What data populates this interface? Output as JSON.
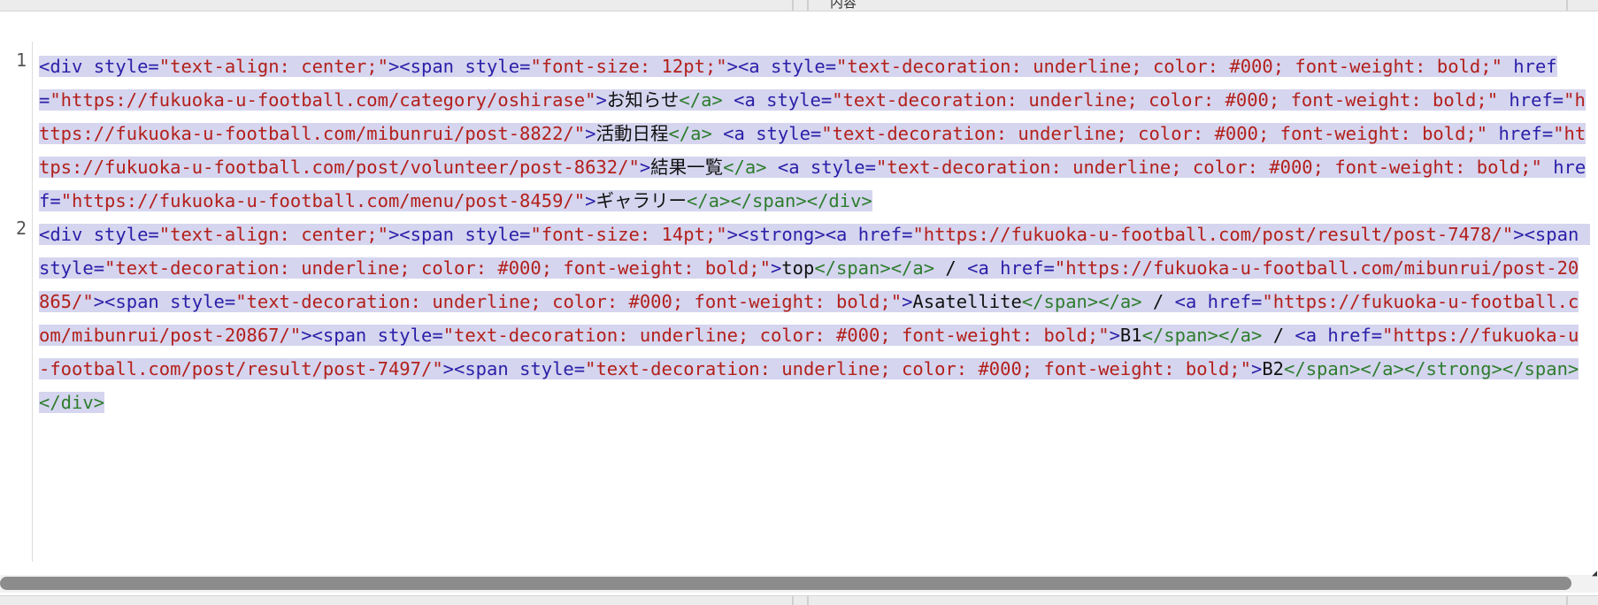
{
  "top_bar": {
    "partial_label": "内容"
  },
  "editor": {
    "lines": [
      {
        "number": "1",
        "segments": [
          {
            "c": "t",
            "v": "<div "
          },
          {
            "c": "t",
            "v": "style="
          },
          {
            "c": "s",
            "v": "\"text-align: center;\""
          },
          {
            "c": "t",
            "v": "><span "
          },
          {
            "c": "t",
            "v": "style="
          },
          {
            "c": "s",
            "v": "\"font-size: 12pt;\""
          },
          {
            "c": "t",
            "v": "><a "
          },
          {
            "c": "t",
            "v": "style="
          },
          {
            "c": "s",
            "v": "\"text-decoration: underline; color: #000; font-weight: bold;\" "
          },
          {
            "c": "t",
            "v": "href="
          },
          {
            "c": "s",
            "v": "\"https://fukuoka-u-football.com/category/oshirase\""
          },
          {
            "c": "t",
            "v": ">"
          },
          {
            "c": "x",
            "v": "お知らせ"
          },
          {
            "c": "g",
            "v": "</a> "
          },
          {
            "c": "t",
            "v": "<a "
          },
          {
            "c": "t",
            "v": "style="
          },
          {
            "c": "s",
            "v": "\"text-decoration: underline; color: #000; font-weight: bold;\" "
          },
          {
            "c": "t",
            "v": "href="
          },
          {
            "c": "s",
            "v": "\"https://fukuoka-u-football.com/mibunrui/post-8822/\""
          },
          {
            "c": "t",
            "v": ">"
          },
          {
            "c": "x",
            "v": "活動日程"
          },
          {
            "c": "g",
            "v": "</a> "
          },
          {
            "c": "t",
            "v": "<a "
          },
          {
            "c": "t",
            "v": "style="
          },
          {
            "c": "s",
            "v": "\"text-decoration: underline; color: #000; font-weight: bold;\" "
          },
          {
            "c": "t",
            "v": "href="
          },
          {
            "c": "s",
            "v": "\"https://fukuoka-u-football.com/post/volunteer/post-8632/\""
          },
          {
            "c": "t",
            "v": ">"
          },
          {
            "c": "x",
            "v": "結果一覧"
          },
          {
            "c": "g",
            "v": "</a> "
          },
          {
            "c": "t",
            "v": "<a "
          },
          {
            "c": "t",
            "v": "style="
          },
          {
            "c": "s",
            "v": "\"text-decoration: underline; color: #000; font-weight: bold;\" "
          },
          {
            "c": "t",
            "v": "href="
          },
          {
            "c": "s",
            "v": "\"https://fukuoka-u-football.com/menu/post-8459/\""
          },
          {
            "c": "t",
            "v": ">"
          },
          {
            "c": "x",
            "v": "ギャラリー"
          },
          {
            "c": "g",
            "v": "</a></span></div>"
          }
        ]
      },
      {
        "number": "2",
        "segments": [
          {
            "c": "t",
            "v": "<div "
          },
          {
            "c": "t",
            "v": "style="
          },
          {
            "c": "s",
            "v": "\"text-align: center;\""
          },
          {
            "c": "t",
            "v": "><span "
          },
          {
            "c": "t",
            "v": "style="
          },
          {
            "c": "s",
            "v": "\"font-size: 14pt;\""
          },
          {
            "c": "t",
            "v": "><strong><a "
          },
          {
            "c": "t",
            "v": "href="
          },
          {
            "c": "s",
            "v": "\"https://fukuoka-u-football.com/post/result/post-7478/\""
          },
          {
            "c": "t",
            "v": "><span "
          },
          {
            "c": "t",
            "v": "style="
          },
          {
            "c": "s",
            "v": "\"text-decoration: underline; color: #000; font-weight: bold;\""
          },
          {
            "c": "t",
            "v": ">"
          },
          {
            "c": "x",
            "v": "top"
          },
          {
            "c": "g",
            "v": "</span></a>"
          },
          {
            "c": "x",
            "v": " / "
          },
          {
            "c": "t",
            "v": "<a "
          },
          {
            "c": "t",
            "v": "href="
          },
          {
            "c": "s",
            "v": "\"https://fukuoka-u-football.com/mibunrui/post-20865/\""
          },
          {
            "c": "t",
            "v": "><span "
          },
          {
            "c": "t",
            "v": "style="
          },
          {
            "c": "s",
            "v": "\"text-decoration: underline; color: #000; font-weight: bold;\""
          },
          {
            "c": "t",
            "v": ">"
          },
          {
            "c": "x",
            "v": "Asatellite"
          },
          {
            "c": "g",
            "v": "</span></a>"
          },
          {
            "c": "x",
            "v": " / "
          },
          {
            "c": "t",
            "v": "<a "
          },
          {
            "c": "t",
            "v": "href="
          },
          {
            "c": "s",
            "v": "\"https://fukuoka-u-football.com/mibunrui/post-20867/\""
          },
          {
            "c": "t",
            "v": "><span "
          },
          {
            "c": "t",
            "v": "style="
          },
          {
            "c": "s",
            "v": "\"text-decoration: underline; color: #000; font-weight: bold;\""
          },
          {
            "c": "t",
            "v": ">"
          },
          {
            "c": "x",
            "v": "B1"
          },
          {
            "c": "g",
            "v": "</span></a>"
          },
          {
            "c": "x",
            "v": " / "
          },
          {
            "c": "t",
            "v": "<a "
          },
          {
            "c": "t",
            "v": "href="
          },
          {
            "c": "s",
            "v": "\"https://fukuoka-u-football.com/post/result/post-7497/\""
          },
          {
            "c": "t",
            "v": "><span "
          },
          {
            "c": "t",
            "v": "style="
          },
          {
            "c": "s",
            "v": "\"text-decoration: underline; color: #000; font-weight: bold;\""
          },
          {
            "c": "t",
            "v": ">"
          },
          {
            "c": "x",
            "v": "B2"
          },
          {
            "c": "g",
            "v": "</span></a></strong></span></div>"
          }
        ]
      }
    ]
  },
  "colors": {
    "selection": "#d5d5ef",
    "tag": "#2a1fa8",
    "string": "#b3201b",
    "text": "#111111",
    "closing_tag": "#2e7d2e"
  }
}
